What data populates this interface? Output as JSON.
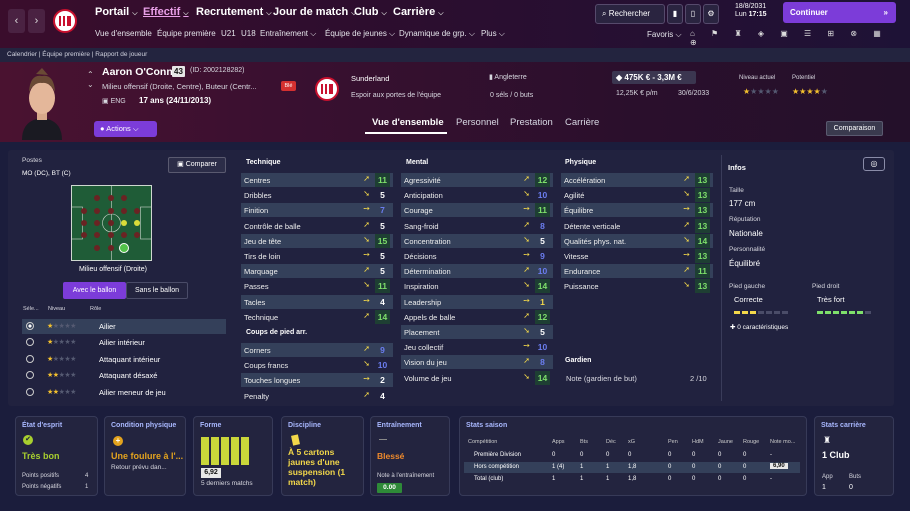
{
  "topbar": {
    "menus": [
      "Portail",
      "Effectif",
      "Recrutement",
      "Jour de match",
      "Club",
      "Carrière"
    ],
    "submenus": [
      "Vue d'ensemble",
      "Équipe première",
      "U21",
      "U18",
      "Entraînement",
      "Équipe de jeunes",
      "Dynamique de grp.",
      "Plus"
    ],
    "search": "Rechercher",
    "date": "18/8/2031",
    "day": "Lun",
    "time": "17:15",
    "continue": "Continuer",
    "favoris": "Favoris"
  },
  "breadcrumb": "Calendrier  |  Équipe première  |  Rapport de joueur",
  "player": {
    "name": "Aaron O'Connell",
    "number": "43",
    "id": "(ID: 2002128282)",
    "position": "Milieu offensif (Droite, Centre), Buteur (Centr...",
    "badge": "Blé",
    "nation": "ENG",
    "age": "17 ans (24/11/2013)",
    "club": "Sunderland",
    "club_status": "Espoir aux portes de l'équipe",
    "country": "Angleterre",
    "caps": "0 séls / 0 buts",
    "value": "475K € - 3,3M €",
    "wage": "12,25K € p/m",
    "contract": "30/6/2033",
    "level_label": "Niveau actuel",
    "potential_label": "Potentiel",
    "actions": "Actions",
    "compare_btn": "Comparaison"
  },
  "tabs": [
    "Vue d'ensemble",
    "Personnel",
    "Prestation",
    "Carrière"
  ],
  "positions": {
    "title": "Postes",
    "current": "MO (DC), BT (C)",
    "compare": "Comparer",
    "role_label": "Milieu offensif (Droite)",
    "with_ball": "Avec le ballon",
    "without_ball": "Sans le ballon",
    "col_sel": "Séle...",
    "col_level": "Niveau",
    "col_role": "Rôle",
    "roles": [
      {
        "name": "Ailier",
        "stars": 1
      },
      {
        "name": "Ailier intérieur",
        "stars": 1
      },
      {
        "name": "Attaquant intérieur",
        "stars": 1
      },
      {
        "name": "Attaquant désaxé",
        "stars": 2
      },
      {
        "name": "Ailier meneur de jeu",
        "stars": 2
      }
    ]
  },
  "technique": {
    "title": "Technique",
    "attrs": [
      [
        "Centres",
        "11"
      ],
      [
        "Dribbles",
        "5"
      ],
      [
        "Finition",
        "7"
      ],
      [
        "Contrôle de balle",
        "5"
      ],
      [
        "Jeu de tête",
        "15"
      ],
      [
        "Tirs de loin",
        "5"
      ],
      [
        "Marquage",
        "5"
      ],
      [
        "Passes",
        "11"
      ],
      [
        "Tacles",
        "4"
      ],
      [
        "Technique",
        "14"
      ]
    ]
  },
  "setpieces": {
    "title": "Coups de pied arr.",
    "attrs": [
      [
        "Corners",
        "9"
      ],
      [
        "Coups francs",
        "10"
      ],
      [
        "Touches longues",
        "2"
      ],
      [
        "Penalty",
        "4"
      ]
    ]
  },
  "mental": {
    "title": "Mental",
    "attrs": [
      [
        "Agressivité",
        "12"
      ],
      [
        "Anticipation",
        "10"
      ],
      [
        "Courage",
        "11"
      ],
      [
        "Sang-froid",
        "8"
      ],
      [
        "Concentration",
        "5"
      ],
      [
        "Décisions",
        "9"
      ],
      [
        "Détermination",
        "10"
      ],
      [
        "Inspiration",
        "14"
      ],
      [
        "Leadership",
        "1"
      ],
      [
        "Appels de balle",
        "12"
      ],
      [
        "Placement",
        "5"
      ],
      [
        "Jeu collectif",
        "10"
      ],
      [
        "Vision du jeu",
        "8"
      ],
      [
        "Volume de jeu",
        "14"
      ]
    ]
  },
  "physique": {
    "title": "Physique",
    "attrs": [
      [
        "Accélération",
        "13"
      ],
      [
        "Agilité",
        "13"
      ],
      [
        "Équilibre",
        "13"
      ],
      [
        "Détente verticale",
        "13"
      ],
      [
        "Qualités phys. nat.",
        "14"
      ],
      [
        "Vitesse",
        "13"
      ],
      [
        "Endurance",
        "11"
      ],
      [
        "Puissance",
        "13"
      ]
    ]
  },
  "goalkeeper": {
    "title": "Gardien",
    "note_label": "Note (gardien de but)",
    "note": "2 /10"
  },
  "info": {
    "title": "Infos",
    "height_label": "Taille",
    "height": "177 cm",
    "rep_label": "Réputation",
    "rep": "Nationale",
    "pers_label": "Personnalité",
    "pers": "Équilibré",
    "lf_label": "Pied gauche",
    "lf": "Correcte",
    "rf_label": "Pied droit",
    "rf": "Très fort",
    "traits": "0 caractéristiques"
  },
  "cards": {
    "mood_title": "État d'esprit",
    "mood": "Très bon",
    "pos_pts": "Points positifs",
    "pos_val": "4",
    "neg_pts": "Points négatifs",
    "neg_val": "1",
    "cond_title": "Condition physique",
    "cond": "Une foulure à l'...",
    "cond_sub": "Retour prévu dan...",
    "form_title": "Forme",
    "form_val": "6,92",
    "form_sub": "5 derniers matchs",
    "disc_title": "Discipline",
    "disc": "À 5 cartons jaunes d'une suspension (1 match)",
    "train_title": "Entraînement",
    "train": "Blessé",
    "train_note_label": "Note à l'entraînement",
    "train_note": "0.00",
    "season_title": "Stats saison",
    "career_title": "Stats carrière",
    "career_club": "1 Club",
    "career_app_label": "App",
    "career_app": "1",
    "career_goals_label": "Buts",
    "career_goals": "0"
  },
  "season": {
    "headers": [
      "Compétition",
      "Apps",
      "Bts",
      "Déc",
      "xG",
      "Pen",
      "HdM",
      "Jaune",
      "Rouge",
      "Note mo..."
    ],
    "rows": [
      [
        "Première Division",
        "0",
        "0",
        "0",
        "0",
        "0",
        "0",
        "0",
        "0",
        "-"
      ],
      [
        "Hors compétition",
        "1 (4)",
        "1",
        "1",
        "1,8",
        "0",
        "0",
        "0",
        "0",
        "6,90"
      ],
      [
        "Total (club)",
        "1",
        "1",
        "1",
        "1,8",
        "0",
        "0",
        "0",
        "0",
        "-"
      ]
    ]
  },
  "colors": {
    "accent": "#7c3cd9",
    "green": "#7ee06b",
    "blue": "#6b7df0"
  }
}
